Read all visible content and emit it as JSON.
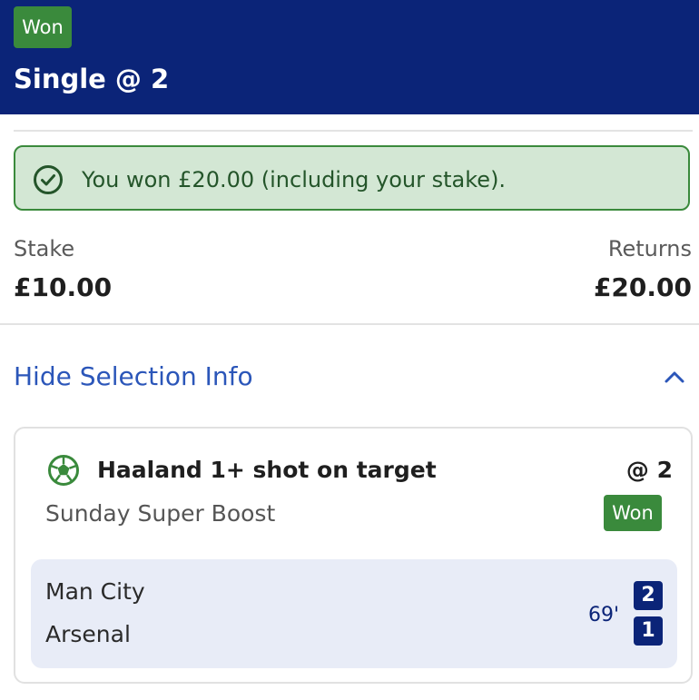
{
  "header": {
    "status": "Won",
    "title": "Single @ 2"
  },
  "result_banner": {
    "icon": "check-circle-icon",
    "message": "You won £20.00 (including your stake)."
  },
  "summary": {
    "stake_label": "Stake",
    "stake_value": "£10.00",
    "returns_label": "Returns",
    "returns_value": "£20.00"
  },
  "selection_toggle": {
    "label": "Hide Selection Info",
    "icon": "chevron-up-icon"
  },
  "selection": {
    "icon": "football-icon",
    "name": "Haaland 1+ shot on target",
    "odds": "@ 2",
    "market": "Sunday Super Boost",
    "status": "Won",
    "match": {
      "home_team": "Man City",
      "away_team": "Arsenal",
      "clock": "69'",
      "home_score": "2",
      "away_score": "1"
    }
  },
  "colors": {
    "header_bg": "#0b2478",
    "won_green": "#3a8a3c",
    "banner_bg": "#d3e7d4",
    "link_blue": "#2b56b9",
    "scoreboard_bg": "#e8ecf7"
  }
}
